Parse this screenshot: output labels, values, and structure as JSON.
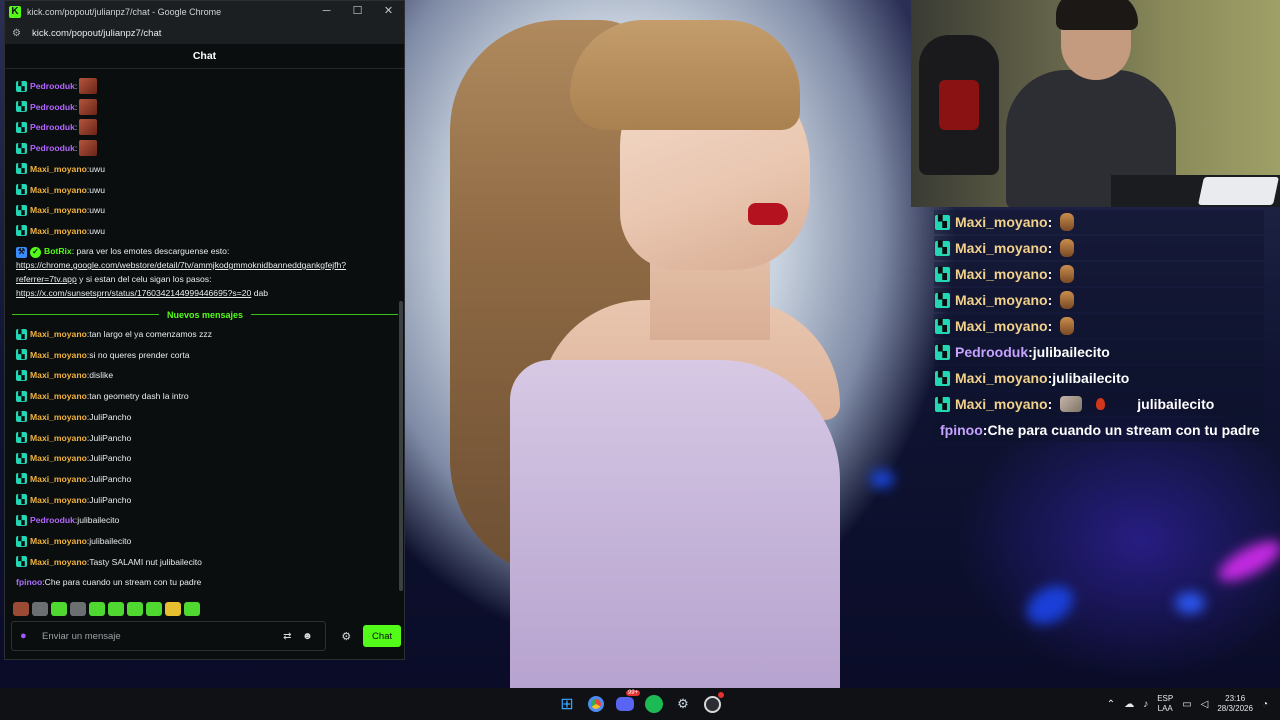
{
  "browser": {
    "window_title": "kick.com/popout/julianpz7/chat - Google Chrome",
    "logo_letter": "K",
    "url": "kick.com/popout/julianpz7/chat",
    "controls": {
      "minimize": "─",
      "maximize": "☐",
      "close": "✕"
    }
  },
  "chat": {
    "header": "Chat",
    "top_messages": [
      {
        "user": "Pedrooduk",
        "sep": ":",
        "text": "",
        "color": "#b266ff",
        "emote": "emote"
      },
      {
        "user": "Pedrooduk",
        "sep": ":",
        "text": "",
        "color": "#b266ff",
        "emote": "emote"
      },
      {
        "user": "Pedrooduk",
        "sep": ":",
        "text": "",
        "color": "#b266ff",
        "emote": "emote"
      },
      {
        "user": "Pedrooduk",
        "sep": ":",
        "text": "",
        "color": "#b266ff",
        "emote": "emote"
      },
      {
        "user": "Maxi_moyano",
        "sep": ":",
        "text": " uwu",
        "color": "#f2b33d"
      },
      {
        "user": "Maxi_moyano",
        "sep": ":",
        "text": " uwu",
        "color": "#f2b33d"
      },
      {
        "user": "Maxi_moyano",
        "sep": ":",
        "text": " uwu",
        "color": "#f2b33d"
      },
      {
        "user": "Maxi_moyano",
        "sep": ":",
        "text": " uwu",
        "color": "#f2b33d"
      }
    ],
    "bot_message": {
      "user": "BotRix",
      "color": "#53fc18",
      "line1": ": para ver los emotes descarguense esto:",
      "link1": "https://chrome.google.com/webstore/detail/7tv/ammjkodgmmoknidbanneddgankgfejfh?referrer=7tv.app",
      "middle": " y si estan del celu sigan los pasos:",
      "link2": "https://x.com/sunsetsprn/status/1760342144999446695?s=20",
      "end": " dab"
    },
    "divider_label": "Nuevos mensajes",
    "new_messages": [
      {
        "user": "Maxi_moyano",
        "sep": ":",
        "text": " tan largo el ya comenzamos zzz",
        "color": "#f2b33d"
      },
      {
        "user": "Maxi_moyano",
        "sep": ":",
        "text": " si no queres prender corta",
        "color": "#f2b33d"
      },
      {
        "user": "Maxi_moyano",
        "sep": ":",
        "text": " dislike",
        "color": "#f2b33d"
      },
      {
        "user": "Maxi_moyano",
        "sep": ":",
        "text": " tan geometry dash la intro",
        "color": "#f2b33d"
      },
      {
        "user": "Maxi_moyano",
        "sep": ":",
        "text": " JuliPancho",
        "color": "#f2b33d"
      },
      {
        "user": "Maxi_moyano",
        "sep": ":",
        "text": " JuliPancho",
        "color": "#f2b33d"
      },
      {
        "user": "Maxi_moyano",
        "sep": ":",
        "text": " JuliPancho",
        "color": "#f2b33d"
      },
      {
        "user": "Maxi_moyano",
        "sep": ":",
        "text": " JuliPancho",
        "color": "#f2b33d"
      },
      {
        "user": "Maxi_moyano",
        "sep": ":",
        "text": " JuliPancho",
        "color": "#f2b33d"
      },
      {
        "user": "Pedrooduk",
        "sep": ":",
        "text": " julibailecito",
        "color": "#b266ff"
      },
      {
        "user": "Maxi_moyano",
        "sep": ":",
        "text": " julibailecito",
        "color": "#f2b33d"
      },
      {
        "user": "Maxi_moyano",
        "sep": ":",
        "text": " Tasty SALAMI nut julibailecito",
        "color": "#f2b33d"
      },
      {
        "user": "fpinoo",
        "sep": ":",
        "text": " Che para cuando un stream con tu padre",
        "color": "#a970ff",
        "no_badge": true
      }
    ],
    "input_placeholder": "Enviar un mensaje",
    "send_label": "Chat"
  },
  "overlay_chat": [
    {
      "user": "Maxi_moyano",
      "sep": " :",
      "text": "",
      "color": "#f2d18a",
      "emote": "hand"
    },
    {
      "user": "Maxi_moyano",
      "sep": " :",
      "text": "",
      "color": "#f2d18a",
      "emote": "hand"
    },
    {
      "user": "Maxi_moyano",
      "sep": " :",
      "text": "",
      "color": "#f2d18a",
      "emote": "hand"
    },
    {
      "user": "Maxi_moyano",
      "sep": " :",
      "text": "",
      "color": "#f2d18a",
      "emote": "hand"
    },
    {
      "user": "Maxi_moyano",
      "sep": " :",
      "text": "",
      "color": "#f2d18a",
      "emote": "hand"
    },
    {
      "user": "Pedrooduk",
      "sep": " :",
      "text": " julibailecito",
      "color": "#c7a2ff"
    },
    {
      "user": "Maxi_moyano",
      "sep": " :",
      "text": " julibailecito",
      "color": "#f2d18a"
    },
    {
      "user": "Maxi_moyano",
      "sep": " :",
      "text": "julibailecito",
      "color": "#f2d18a",
      "emote": "cat"
    },
    {
      "user": "fpinoo",
      "sep": " :",
      "text": " Che para cuando un stream con tu padre",
      "color": "#c7a2ff",
      "no_badge": true
    }
  ],
  "taskbar": {
    "apps": [
      "windows-start",
      "chrome",
      "discord",
      "spotify",
      "steam",
      "obs"
    ],
    "discord_badge": "99+",
    "language_line1": "ESP",
    "language_line2": "LAA",
    "time": "23:16",
    "date": "28/3/2026"
  }
}
